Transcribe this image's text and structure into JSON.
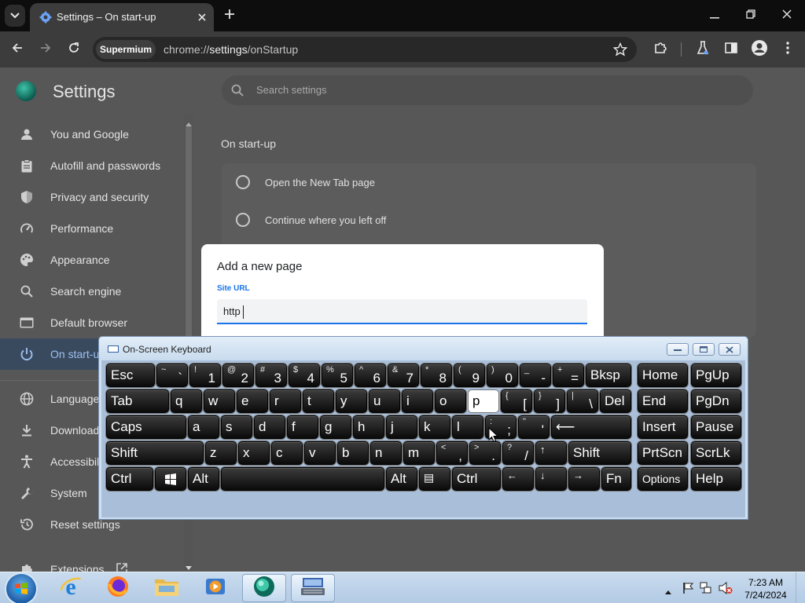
{
  "browser": {
    "tab_title": "Settings – On start-up",
    "omnibox_chip": "Supermium",
    "url_prefix": "chrome://",
    "url_host": "settings",
    "url_path": "/onStartup"
  },
  "settings": {
    "title": "Settings",
    "search_placeholder": "Search settings",
    "nav": [
      {
        "label": "You and Google",
        "icon": "person-icon"
      },
      {
        "label": "Autofill and passwords",
        "icon": "clipboard-icon"
      },
      {
        "label": "Privacy and security",
        "icon": "shield-icon"
      },
      {
        "label": "Performance",
        "icon": "speedometer-icon"
      },
      {
        "label": "Appearance",
        "icon": "palette-icon"
      },
      {
        "label": "Search engine",
        "icon": "search-icon"
      },
      {
        "label": "Default browser",
        "icon": "browser-window-icon"
      },
      {
        "label": "On start-up",
        "icon": "power-icon"
      },
      {
        "label": "Languages",
        "icon": "globe-icon"
      },
      {
        "label": "Downloads",
        "icon": "download-icon"
      },
      {
        "label": "Accessibility",
        "icon": "accessibility-icon"
      },
      {
        "label": "System",
        "icon": "wrench-icon"
      },
      {
        "label": "Reset settings",
        "icon": "reset-icon"
      },
      {
        "label": "Extensions",
        "icon": "puzzle-icon"
      }
    ],
    "section_title": "On start-up",
    "options": [
      {
        "label": "Open the New Tab page"
      },
      {
        "label": "Continue where you left off"
      }
    ]
  },
  "dialog": {
    "title": "Add a new page",
    "field_label": "Site URL",
    "field_value": "http"
  },
  "osk": {
    "title": "On-Screen Keyboard",
    "rows": [
      [
        {
          "main": "Esc"
        },
        {
          "shift": "~",
          "low": "`"
        },
        {
          "shift": "!",
          "low": "1"
        },
        {
          "shift": "@",
          "low": "2"
        },
        {
          "shift": "#",
          "low": "3"
        },
        {
          "shift": "$",
          "low": "4"
        },
        {
          "shift": "%",
          "low": "5"
        },
        {
          "shift": "^",
          "low": "6"
        },
        {
          "shift": "&",
          "low": "7"
        },
        {
          "shift": "*",
          "low": "8"
        },
        {
          "shift": "(",
          "low": "9"
        },
        {
          "shift": ")",
          "low": "0"
        },
        {
          "shift": "_",
          "low": "-"
        },
        {
          "shift": "+",
          "low": "="
        },
        {
          "main": "Bksp"
        },
        {
          "main": "Home"
        },
        {
          "main": "PgUp"
        }
      ],
      [
        {
          "main": "Tab"
        },
        {
          "main": "q"
        },
        {
          "main": "w"
        },
        {
          "main": "e"
        },
        {
          "main": "r"
        },
        {
          "main": "t"
        },
        {
          "main": "y"
        },
        {
          "main": "u"
        },
        {
          "main": "i"
        },
        {
          "main": "o"
        },
        {
          "main": "p"
        },
        {
          "shift": "{",
          "low": "["
        },
        {
          "shift": "}",
          "low": "]"
        },
        {
          "shift": "|",
          "low": "\\"
        },
        {
          "main": "Del"
        },
        {
          "main": "End"
        },
        {
          "main": "PgDn"
        }
      ],
      [
        {
          "main": "Caps"
        },
        {
          "main": "a"
        },
        {
          "main": "s"
        },
        {
          "main": "d"
        },
        {
          "main": "f"
        },
        {
          "main": "g"
        },
        {
          "main": "h"
        },
        {
          "main": "j"
        },
        {
          "main": "k"
        },
        {
          "main": "l"
        },
        {
          "shift": ":",
          "low": ";"
        },
        {
          "shift": "\"",
          "low": "'"
        },
        {
          "main": "⟵"
        },
        {
          "main": "Insert"
        },
        {
          "main": "Pause"
        }
      ],
      [
        {
          "main": "Shift"
        },
        {
          "main": "z"
        },
        {
          "main": "x"
        },
        {
          "main": "c"
        },
        {
          "main": "v"
        },
        {
          "main": "b"
        },
        {
          "main": "n"
        },
        {
          "main": "m"
        },
        {
          "shift": "<",
          "low": ","
        },
        {
          "shift": ">",
          "low": "."
        },
        {
          "shift": "?",
          "low": "/"
        },
        {
          "main": "↑"
        },
        {
          "main": "Shift"
        },
        {
          "main": "PrtScn"
        },
        {
          "main": "ScrLk"
        }
      ],
      [
        {
          "main": "Ctrl"
        },
        {
          "main": ""
        },
        {
          "main": "Alt"
        },
        {
          "main": ""
        },
        {
          "main": "Alt"
        },
        {
          "main": "▤"
        },
        {
          "main": "Ctrl"
        },
        {
          "main": "←"
        },
        {
          "main": "↓"
        },
        {
          "main": "→"
        },
        {
          "main": "Fn"
        },
        {
          "main": "Options"
        },
        {
          "main": "Help"
        }
      ]
    ],
    "pressed_key": "p"
  },
  "taskbar": {
    "time": "7:23 AM",
    "date": "7/24/2024"
  },
  "colors": {
    "accent": "#1a73e8",
    "taskbar": "#c2d6ec"
  }
}
